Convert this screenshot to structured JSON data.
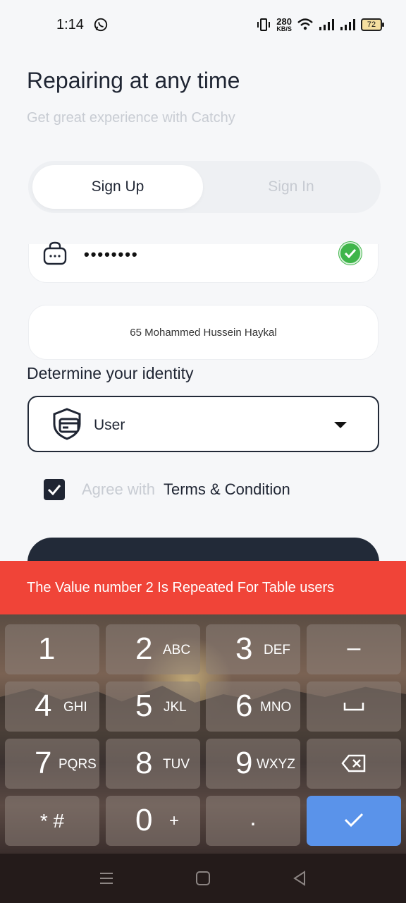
{
  "status_bar": {
    "time": "1:14",
    "speed_value": "280",
    "speed_unit": "KB/S",
    "battery": "72",
    "icons": [
      "whatsapp-icon",
      "vibrate-icon",
      "wifi-icon",
      "signal-icon",
      "signal-icon",
      "battery-icon"
    ]
  },
  "header": {
    "title": "Repairing at any time",
    "subtitle": "Get great experience with Catchy"
  },
  "tabs": [
    {
      "label": "Sign Up",
      "active": true
    },
    {
      "label": "Sign In",
      "active": false
    }
  ],
  "form": {
    "password_mask": "••••••••",
    "address_value": "65 Mohammed Hussein Haykal",
    "identity_label": "Determine your identity",
    "identity_value": "User",
    "agree_prefix": "Agree with",
    "agree_link": "Terms & Condition",
    "agree_checked": true
  },
  "toast": {
    "message": "The Value number 2 Is Repeated For Table users",
    "color": "#f04438"
  },
  "keyboard": {
    "keys": [
      {
        "main": "1",
        "sub": ""
      },
      {
        "main": "2",
        "sub": "ABC"
      },
      {
        "main": "3",
        "sub": "DEF"
      },
      {
        "main": "–",
        "sub": ""
      },
      {
        "main": "4",
        "sub": "GHI"
      },
      {
        "main": "5",
        "sub": "JKL"
      },
      {
        "main": "6",
        "sub": "MNO"
      },
      {
        "main": "␣",
        "sub": ""
      },
      {
        "main": "7",
        "sub": "PQRS"
      },
      {
        "main": "8",
        "sub": "TUV"
      },
      {
        "main": "9",
        "sub": "WXYZ"
      },
      {
        "main": "⌫",
        "sub": ""
      },
      {
        "main": "* #",
        "sub": ""
      },
      {
        "main": "0",
        "sub": "+"
      },
      {
        "main": ".",
        "sub": ""
      },
      {
        "main": "✓",
        "sub": ""
      }
    ]
  },
  "colors": {
    "primary": "#222a38",
    "accent_ok": "#5a93ea",
    "success": "#3fb54a"
  }
}
